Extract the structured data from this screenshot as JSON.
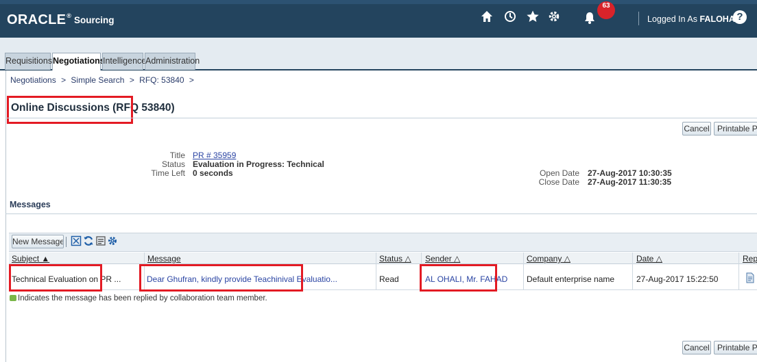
{
  "header": {
    "logo": "ORACLE",
    "logo_mark": "®",
    "product": "Sourcing",
    "notifications_count": "63",
    "logged_in_prefix": "Logged In As",
    "username": "FALOHALI",
    "help_glyph": "?"
  },
  "tabs": [
    {
      "label": "Requisitions",
      "active": false
    },
    {
      "label": "Negotiations",
      "active": true
    },
    {
      "label": "Intelligence",
      "active": false
    },
    {
      "label": "Administration",
      "active": false
    }
  ],
  "breadcrumb": [
    {
      "label": "Negotiations"
    },
    {
      "label": ">"
    },
    {
      "label": "Simple Search"
    },
    {
      "label": ">"
    },
    {
      "label": "RFQ: 53840"
    },
    {
      "label": ">"
    }
  ],
  "page_title": "Online Discussions (RFQ 53840)",
  "buttons": {
    "cancel": "Cancel",
    "printable": "Printable Page"
  },
  "details": {
    "title_label": "Title",
    "title_value": "PR # 35959",
    "status_label": "Status",
    "status_value": "Evaluation in Progress: Technical",
    "time_left_label": "Time Left",
    "time_left_value": "0 seconds",
    "open_date_label": "Open Date",
    "open_date_value": "27-Aug-2017 10:30:35",
    "close_date_label": "Close Date",
    "close_date_value": "27-Aug-2017 11:30:35"
  },
  "messages": {
    "section_title": "Messages",
    "new_message_label": "New Message",
    "columns": {
      "subject": "Subject ▲",
      "message": "Message",
      "status": "Status △",
      "sender": "Sender △",
      "company": "Company △",
      "date": "Date △",
      "reply": "Reply"
    },
    "rows": [
      {
        "subject": "Technical Evaluation on PR ...",
        "message": "Dear Ghufran, kindly provide Teachinival Evaluatio...",
        "status": "Read",
        "sender": "AL OHALI, Mr. FAHAD",
        "company": "Default enterprise name",
        "date": "27-Aug-2017 15:22:50"
      }
    ],
    "legend": "Indicates the message has been replied by collaboration team member."
  },
  "colors": {
    "header_bg": "#23445e",
    "highlight_red": "#e31a23",
    "link_blue": "#2a44a3"
  }
}
